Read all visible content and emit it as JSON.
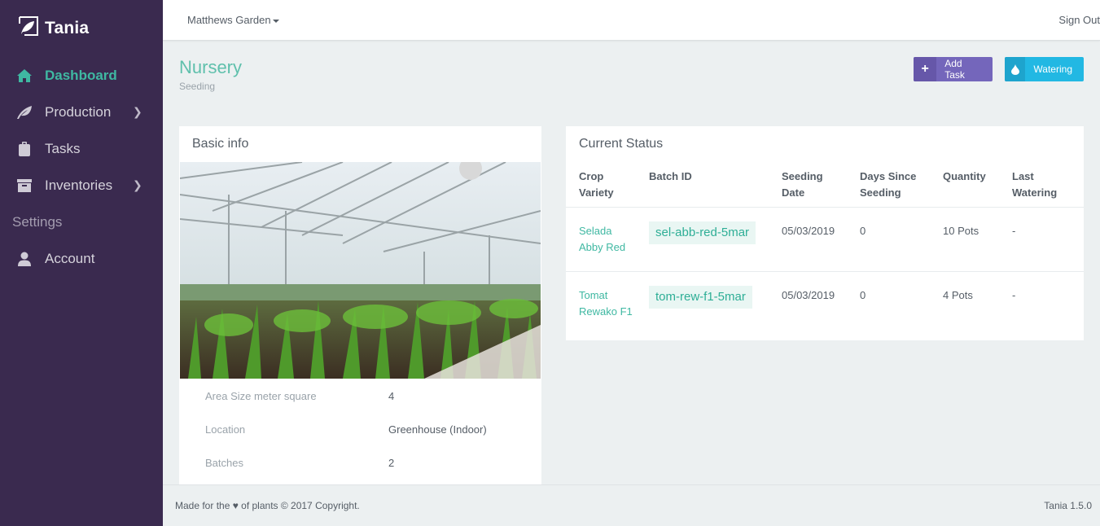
{
  "app": {
    "name": "Tania",
    "version_label": "Tania 1.5.0"
  },
  "sidebar": {
    "items": [
      {
        "label": "Dashboard",
        "icon": "home-icon",
        "active": true,
        "has_submenu": false
      },
      {
        "label": "Production",
        "icon": "leaf-icon",
        "active": false,
        "has_submenu": true
      },
      {
        "label": "Tasks",
        "icon": "clipboard-icon",
        "active": false,
        "has_submenu": false
      },
      {
        "label": "Inventories",
        "icon": "archive-icon",
        "active": false,
        "has_submenu": true
      }
    ],
    "section_label": "Settings",
    "settings_items": [
      {
        "label": "Account",
        "icon": "user-icon"
      }
    ]
  },
  "topbar": {
    "farm_name": "Matthews Garden",
    "sign_out": "Sign Out"
  },
  "page": {
    "title": "Nursery",
    "subtitle": "Seeding",
    "buttons": {
      "add_task": "Add Task",
      "watering": "Watering"
    }
  },
  "basic_info": {
    "title": "Basic info",
    "image_alt": "Greenhouse with seedlings",
    "fields": [
      {
        "label": "Area Size meter square",
        "value": "4"
      },
      {
        "label": "Location",
        "value": "Greenhouse (Indoor)"
      },
      {
        "label": "Batches",
        "value": "2"
      }
    ]
  },
  "current_status": {
    "title": "Current Status",
    "columns": [
      "Crop Variety",
      "Batch ID",
      "Seeding Date",
      "Days Since Seeding",
      "Quantity",
      "Last Watering"
    ],
    "rows": [
      {
        "crop": "Selada",
        "variety": "Abby Red",
        "batch_id": "sel-abb-red-5mar",
        "seeding_date": "05/03/2019",
        "days_since": "0",
        "quantity": "10 Pots",
        "last_watering": "-"
      },
      {
        "crop": "Tomat",
        "variety": "Rewako F1",
        "batch_id": "tom-rew-f1-5mar",
        "seeding_date": "05/03/2019",
        "days_since": "0",
        "quantity": "4 Pots",
        "last_watering": "-"
      }
    ]
  },
  "footer": {
    "left": "Made for the ♥ of plants © 2017 Copyright.",
    "right": "Tania 1.5.0"
  },
  "colors": {
    "sidebar_bg": "#3a2a4f",
    "accent": "#3fb8a2",
    "add_task": "#7466bb",
    "watering": "#22b8e3"
  }
}
